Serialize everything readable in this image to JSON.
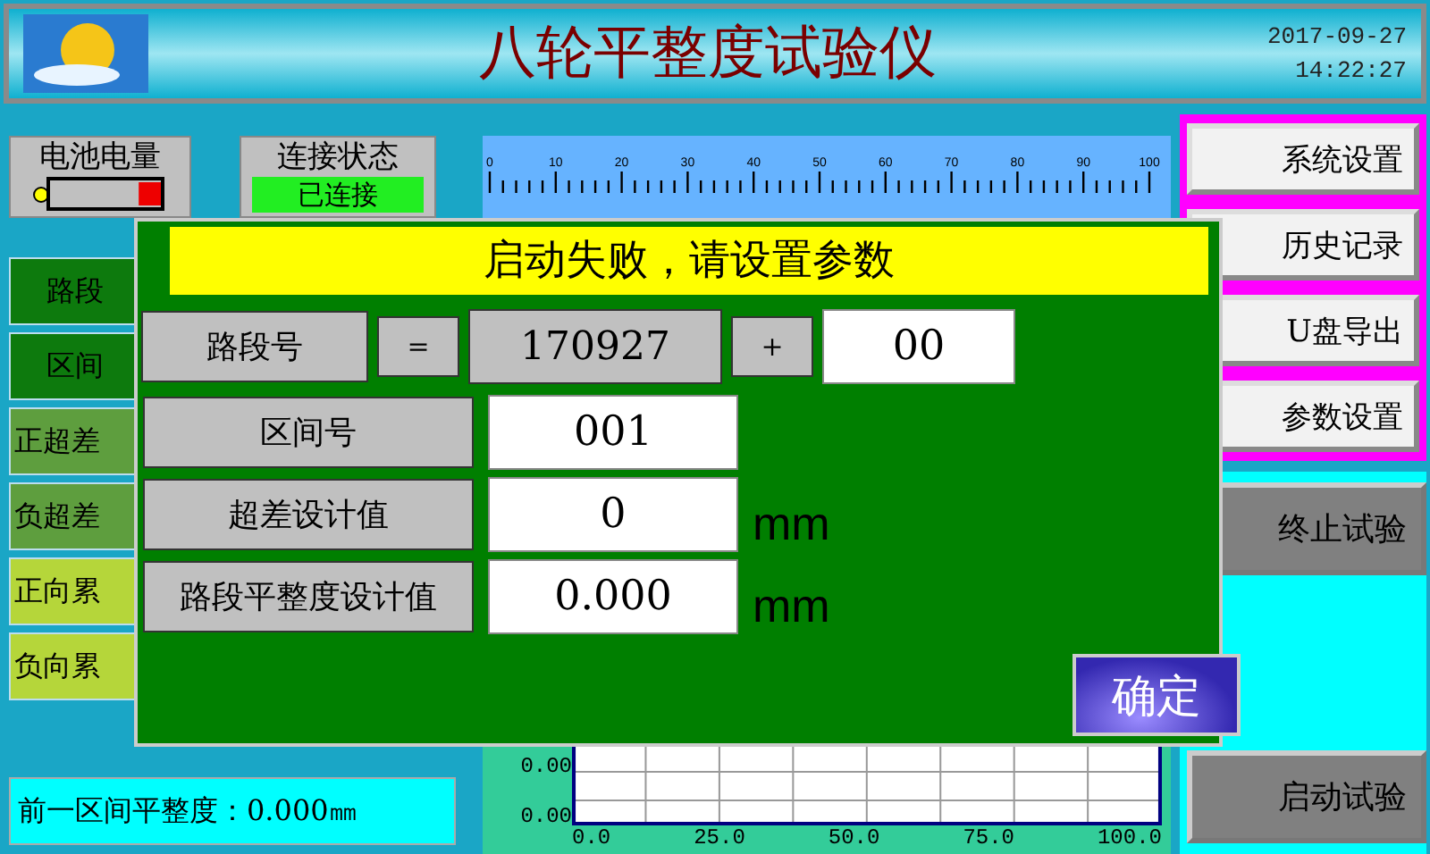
{
  "header": {
    "title": "八轮平整度试验仪",
    "date": "2017-09-27",
    "time": "14:22:27"
  },
  "battery": {
    "label": "电池电量",
    "level": 0.2
  },
  "connection": {
    "label": "连接状态",
    "value": "已连接"
  },
  "left_items": [
    {
      "label": "路段",
      "kind": "dark"
    },
    {
      "label": "区间",
      "kind": "dark"
    },
    {
      "label": "正超差",
      "kind": "olive"
    },
    {
      "label": "负超差",
      "kind": "olive"
    },
    {
      "label": "正向累",
      "kind": "lime"
    },
    {
      "label": "负向累",
      "kind": "lime"
    }
  ],
  "previous_flatness": "前一区间平整度：0.000㎜",
  "ruler": {
    "labels": [
      "0",
      "10",
      "20",
      "30",
      "40",
      "50",
      "60",
      "70",
      "80",
      "90",
      "100"
    ]
  },
  "chart": {
    "y_labels": [
      "0.00",
      "0.00"
    ],
    "x_labels": [
      "0.0",
      "25.0",
      "50.0",
      "75.0",
      "100.0"
    ]
  },
  "right_buttons": [
    "系统设置",
    "历史记录",
    "U盘导出",
    "参数设置"
  ],
  "stop_button": "终止试验",
  "start_button": "启动试验",
  "dialog": {
    "title": "启动失败，请设置参数",
    "road_label": "路段号",
    "equals": "=",
    "road_number": "170927",
    "plus": "+",
    "road_suffix": "00",
    "rows": [
      {
        "label": "区间号",
        "value": "001"
      },
      {
        "label": "超差设计值",
        "value": "0",
        "unit": "mm"
      },
      {
        "label": "路段平整度设计值",
        "value": "0.000",
        "unit": "mm"
      }
    ],
    "confirm": "确定"
  }
}
